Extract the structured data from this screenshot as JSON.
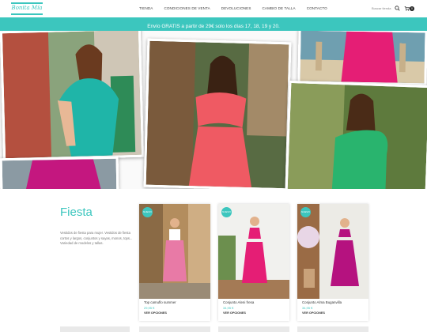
{
  "header": {
    "logo_text": "Bonita Mía",
    "nav": [
      "TIENDA",
      "CONDICIONES DE VENTA",
      "DEVOLUCIONES",
      "CAMBIO DE TALLA",
      "CONTACTO"
    ],
    "search_label": "Buscar tienda",
    "cart_count": "0"
  },
  "announcement": "Envío GRATIS a partir de 29€ solo los días 17, 18, 19 y 20.",
  "collection": {
    "title": "Fiesta",
    "description": "Vestidos de fiesta para mujer. Vestidos de fiesta cortos y largos, conjuntos y sayas, monos, tops... Variedad de modelos y tallas."
  },
  "products": [
    {
      "badge": "NUEVO",
      "name": "Top camuflo summer",
      "price": "29,95 €",
      "button": "VER OPCIONES"
    },
    {
      "badge": "NUEVO",
      "name": "Conjunto Aleni fresa",
      "price": "34,95 €",
      "button": "VER OPCIONES"
    },
    {
      "badge": "NUEVO",
      "name": "Conjunto Alma Buganvilla",
      "price": "34,95 €",
      "button": "VER OPCIONES"
    }
  ],
  "colors": {
    "accent": "#3cc6be",
    "turquoise_dress": "#1fb5a8",
    "coral_dress": "#ef5a63",
    "green_dress": "#29b46e",
    "magenta": "#c4177f",
    "fuchsia": "#e51e75"
  },
  "icons": [
    "search-icon",
    "cart-icon"
  ]
}
